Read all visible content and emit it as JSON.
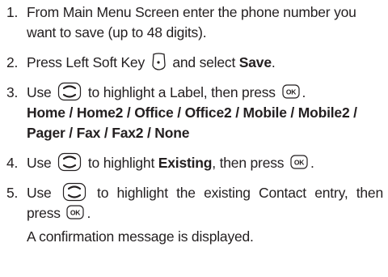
{
  "steps": [
    {
      "number": "1.",
      "line1": "From Main Menu Screen enter the phone number you",
      "line2": "want to save (up to 48 digits)."
    },
    {
      "number": "2.",
      "text_before": "Press Left Soft Key",
      "text_mid": "and select",
      "bold": "Save",
      "text_after": "."
    },
    {
      "number": "3.",
      "text_before": "Use",
      "text_mid": "to highlight a Label, then press",
      "text_after": ".",
      "labels": [
        "Home",
        "Home2",
        "Office",
        "Office2",
        "Mobile",
        "Mobile2",
        "Pager",
        "Fax",
        "Fax2",
        "None"
      ],
      "separator": " / "
    },
    {
      "number": "4.",
      "text_before": "Use",
      "text_mid": "to highlight",
      "bold": "Existing",
      "text_mid2": ", then press",
      "text_after": "."
    },
    {
      "number": "5.",
      "text_before": "Use",
      "text_mid": "to highlight the existing Contact entry, then",
      "line2_before": "press",
      "text_after": ".",
      "result": "A confirmation message is displayed."
    }
  ],
  "icons": {
    "left_soft_key": "left-soft-key-icon",
    "navigation_key": "navigation-key-icon",
    "ok_key": "ok-key-icon",
    "ok_label": "OK"
  }
}
